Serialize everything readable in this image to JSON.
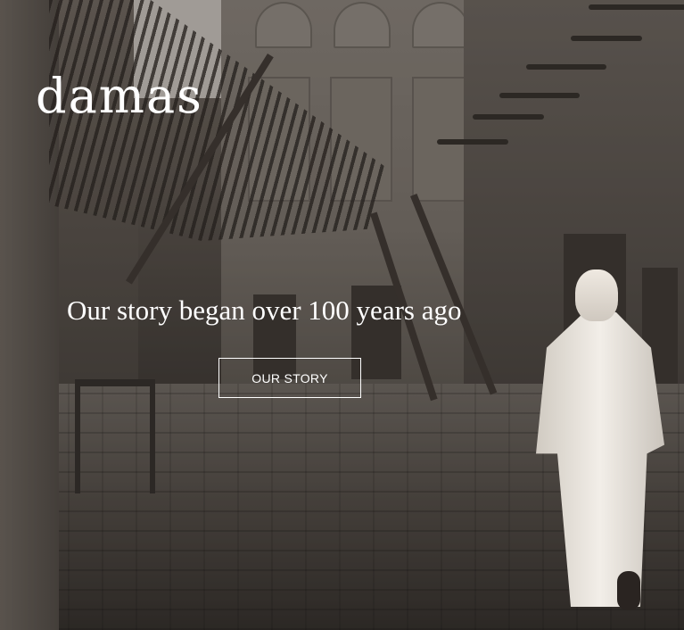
{
  "brand": {
    "logo_text": "damas"
  },
  "hero": {
    "headline": "Our story began over 100 years ago",
    "cta_label": "OUR STORY"
  },
  "colors": {
    "text": "#ffffff",
    "overlay": "#28231f"
  }
}
